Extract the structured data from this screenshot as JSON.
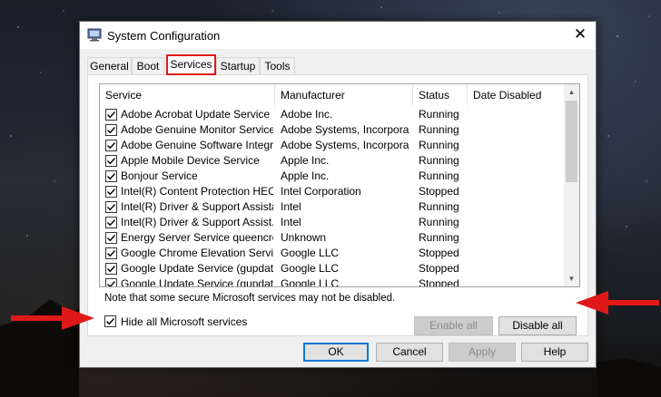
{
  "window": {
    "title": "System Configuration",
    "close_glyph": "✕"
  },
  "tabs": [
    {
      "label": "General"
    },
    {
      "label": "Boot"
    },
    {
      "label": "Services",
      "active": true
    },
    {
      "label": "Startup"
    },
    {
      "label": "Tools"
    }
  ],
  "columns": [
    "Service",
    "Manufacturer",
    "Status",
    "Date Disabled"
  ],
  "services": [
    {
      "name": "Adobe Acrobat Update Service",
      "manufacturer": "Adobe Inc.",
      "status": "Running",
      "date_disabled": "",
      "checked": true
    },
    {
      "name": "Adobe Genuine Monitor Service",
      "manufacturer": "Adobe Systems, Incorpora...",
      "status": "Running",
      "date_disabled": "",
      "checked": true
    },
    {
      "name": "Adobe Genuine Software Integri...",
      "manufacturer": "Adobe Systems, Incorpora...",
      "status": "Running",
      "date_disabled": "",
      "checked": true
    },
    {
      "name": "Apple Mobile Device Service",
      "manufacturer": "Apple Inc.",
      "status": "Running",
      "date_disabled": "",
      "checked": true
    },
    {
      "name": "Bonjour Service",
      "manufacturer": "Apple Inc.",
      "status": "Running",
      "date_disabled": "",
      "checked": true
    },
    {
      "name": "Intel(R) Content Protection HEC...",
      "manufacturer": "Intel Corporation",
      "status": "Stopped",
      "date_disabled": "",
      "checked": true
    },
    {
      "name": "Intel(R) Driver & Support Assistant",
      "manufacturer": "Intel",
      "status": "Running",
      "date_disabled": "",
      "checked": true
    },
    {
      "name": "Intel(R) Driver & Support Assist...",
      "manufacturer": "Intel",
      "status": "Running",
      "date_disabled": "",
      "checked": true
    },
    {
      "name": "Energy Server Service queencreek",
      "manufacturer": "Unknown",
      "status": "Running",
      "date_disabled": "",
      "checked": true
    },
    {
      "name": "Google Chrome Elevation Servic...",
      "manufacturer": "Google LLC",
      "status": "Stopped",
      "date_disabled": "",
      "checked": true
    },
    {
      "name": "Google Update Service (gupdate)",
      "manufacturer": "Google LLC",
      "status": "Stopped",
      "date_disabled": "",
      "checked": true
    },
    {
      "name": "Google Update Service (gupdatem)",
      "manufacturer": "Google LLC",
      "status": "Stopped",
      "date_disabled": "",
      "checked": true
    }
  ],
  "note": "Note that some secure Microsoft services may not be disabled.",
  "enable_all": {
    "label": "Enable all",
    "enabled": false
  },
  "disable_all": {
    "label": "Disable all",
    "enabled": true
  },
  "hide_microsoft": {
    "label": "Hide all Microsoft services",
    "checked": true
  },
  "footer": {
    "ok": "OK",
    "cancel": "Cancel",
    "apply": "Apply",
    "help": "Help"
  },
  "colors": {
    "annotation_arrow": "#e01818",
    "active_tab_highlight": "#e01818",
    "default_button_border": "#0078d7"
  }
}
